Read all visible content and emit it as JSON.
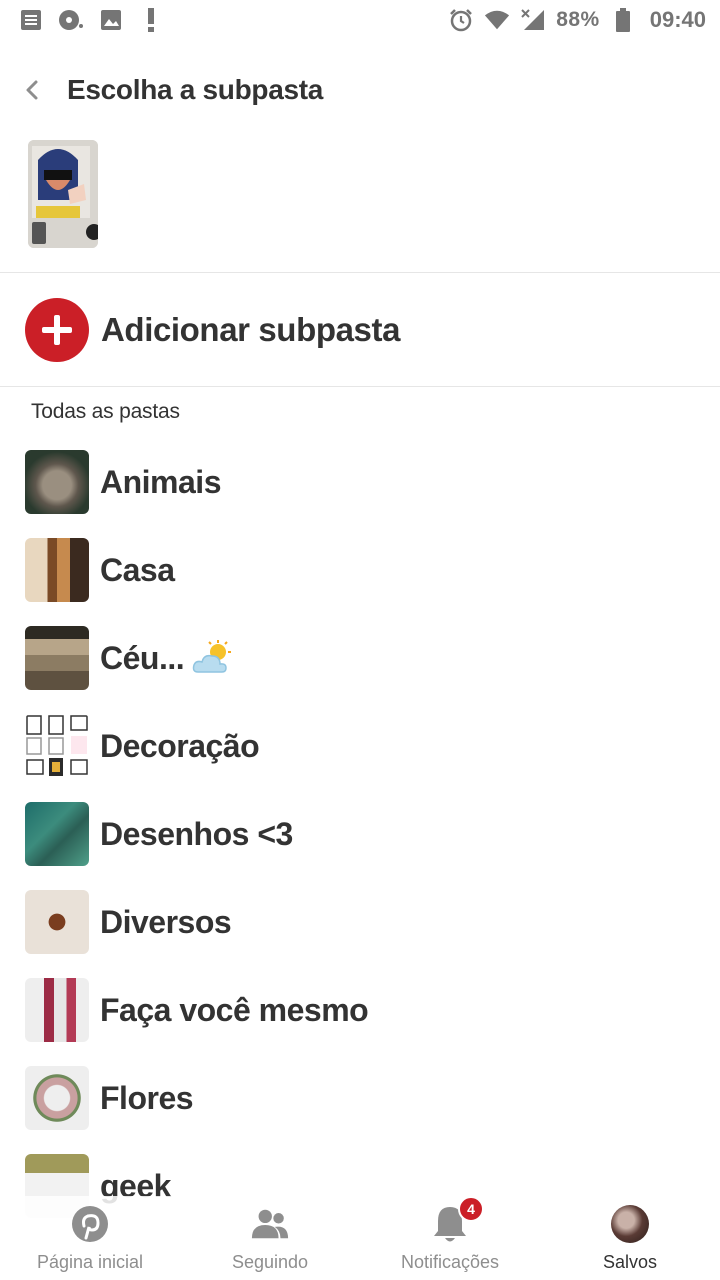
{
  "status_bar": {
    "battery": "88%",
    "time": "09:40"
  },
  "header": {
    "title": "Escolha a subpasta"
  },
  "add_subfolder": {
    "label": "Adicionar subpasta"
  },
  "section": {
    "label": "Todas as pastas"
  },
  "boards": [
    {
      "name": "Animais"
    },
    {
      "name": "Casa"
    },
    {
      "name": "Céu..."
    },
    {
      "name": "Decoração"
    },
    {
      "name": "Desenhos <3"
    },
    {
      "name": "Diversos"
    },
    {
      "name": "Faça você mesmo"
    },
    {
      "name": "Flores"
    },
    {
      "name": "geek"
    }
  ],
  "bottom_nav": {
    "home": "Página inicial",
    "following": "Seguindo",
    "notifications": "Notificações",
    "notifications_badge": "4",
    "saved": "Salvos"
  },
  "colors": {
    "accent": "#cb1f27",
    "text": "#333333",
    "muted": "#8e8e8e"
  }
}
